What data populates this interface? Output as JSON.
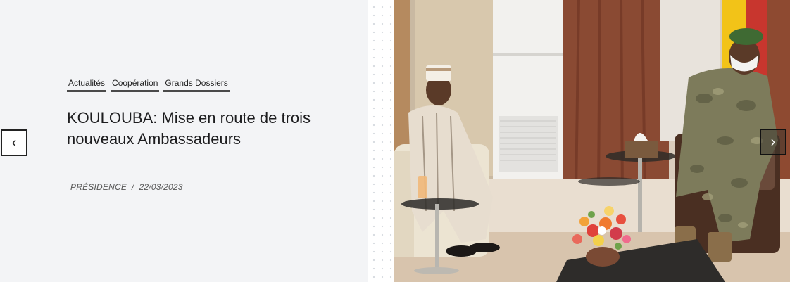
{
  "slider": {
    "categories": [
      "Actualités",
      "Coopération",
      "Grands Dossiers"
    ],
    "title": "KOULOUBA: Mise en route de trois nouveaux Ambassadeurs",
    "author": "PRÉSIDENCE",
    "separator": "/",
    "date": "22/03/2023",
    "prev_label": "‹",
    "next_label": "›"
  },
  "colors": {
    "background": "#f3f4f6",
    "category_underline": "#4a4a4a",
    "title": "#1d1d1f"
  },
  "icons": {
    "prev": "chevron-left-icon",
    "next": "chevron-right-icon"
  }
}
